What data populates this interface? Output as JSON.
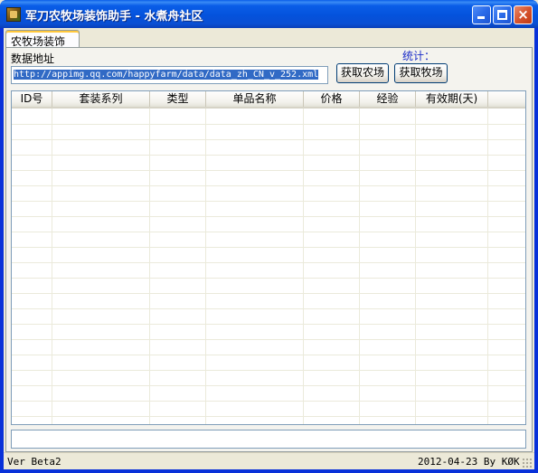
{
  "window": {
    "title": "军刀农牧场装饰助手 - 水煮舟社区",
    "buttons": {
      "minimize": "minimize-icon",
      "maximize": "maximize-icon",
      "close": "×"
    }
  },
  "tabs": [
    {
      "label": "农牧场装饰",
      "selected": true
    }
  ],
  "form": {
    "data_address_label": "数据地址",
    "url_value": "http://appimg.qq.com/happyfarm/data/data_zh_CN_v_252.xml",
    "stats_label": "统计：",
    "get_farm_button": "获取农场",
    "get_ranch_button": "获取牧场"
  },
  "table": {
    "columns": [
      "ID号",
      "套装系列",
      "类型",
      "单品名称",
      "价格",
      "经验",
      "有效期(天)"
    ],
    "rows": []
  },
  "status": {
    "left": "Ver Beta2",
    "right": "2012-04-23 By KØK"
  },
  "colors": {
    "titlebar": "#0a5ee8",
    "close_button": "#d6542e",
    "stat_label": "#1a2bc8",
    "selection": "#316ac5"
  }
}
